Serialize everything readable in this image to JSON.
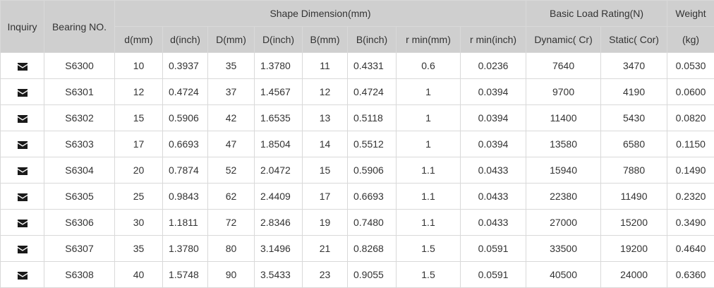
{
  "header": {
    "inquiry": "Inquiry",
    "bearing_no": "Bearing NO.",
    "shape_dimension": "Shape Dimension(mm)",
    "basic_load_rating": "Basic Load Rating(N)",
    "weight": "Weight",
    "sub": [
      "d(mm)",
      "d(inch)",
      "D(mm)",
      "D(inch)",
      "B(mm)",
      "B(inch)",
      "r min(mm)",
      "r min(inch)",
      "Dynamic( Cr)",
      "Static( Cor)",
      "(kg)"
    ]
  },
  "icons": {
    "inquiry": "envelope-icon"
  },
  "rows": [
    [
      "S6300",
      "10",
      "0.3937",
      "35",
      "1.3780",
      "11",
      "0.4331",
      "0.6",
      "0.0236",
      "7640",
      "3470",
      "0.0530"
    ],
    [
      "S6301",
      "12",
      "0.4724",
      "37",
      "1.4567",
      "12",
      "0.4724",
      "1",
      "0.0394",
      "9700",
      "4190",
      "0.0600"
    ],
    [
      "S6302",
      "15",
      "0.5906",
      "42",
      "1.6535",
      "13",
      "0.5118",
      "1",
      "0.0394",
      "11400",
      "5430",
      "0.0820"
    ],
    [
      "S6303",
      "17",
      "0.6693",
      "47",
      "1.8504",
      "14",
      "0.5512",
      "1",
      "0.0394",
      "13580",
      "6580",
      "0.1150"
    ],
    [
      "S6304",
      "20",
      "0.7874",
      "52",
      "2.0472",
      "15",
      "0.5906",
      "1.1",
      "0.0433",
      "15940",
      "7880",
      "0.1490"
    ],
    [
      "S6305",
      "25",
      "0.9843",
      "62",
      "2.4409",
      "17",
      "0.6693",
      "1.1",
      "0.0433",
      "22380",
      "11490",
      "0.2320"
    ],
    [
      "S6306",
      "30",
      "1.1811",
      "72",
      "2.8346",
      "19",
      "0.7480",
      "1.1",
      "0.0433",
      "27000",
      "15200",
      "0.3490"
    ],
    [
      "S6307",
      "35",
      "1.3780",
      "80",
      "3.1496",
      "21",
      "0.8268",
      "1.5",
      "0.0591",
      "33500",
      "19200",
      "0.4640"
    ],
    [
      "S6308",
      "40",
      "1.5748",
      "90",
      "3.5433",
      "23",
      "0.9055",
      "1.5",
      "0.0591",
      "40500",
      "24000",
      "0.6360"
    ]
  ]
}
